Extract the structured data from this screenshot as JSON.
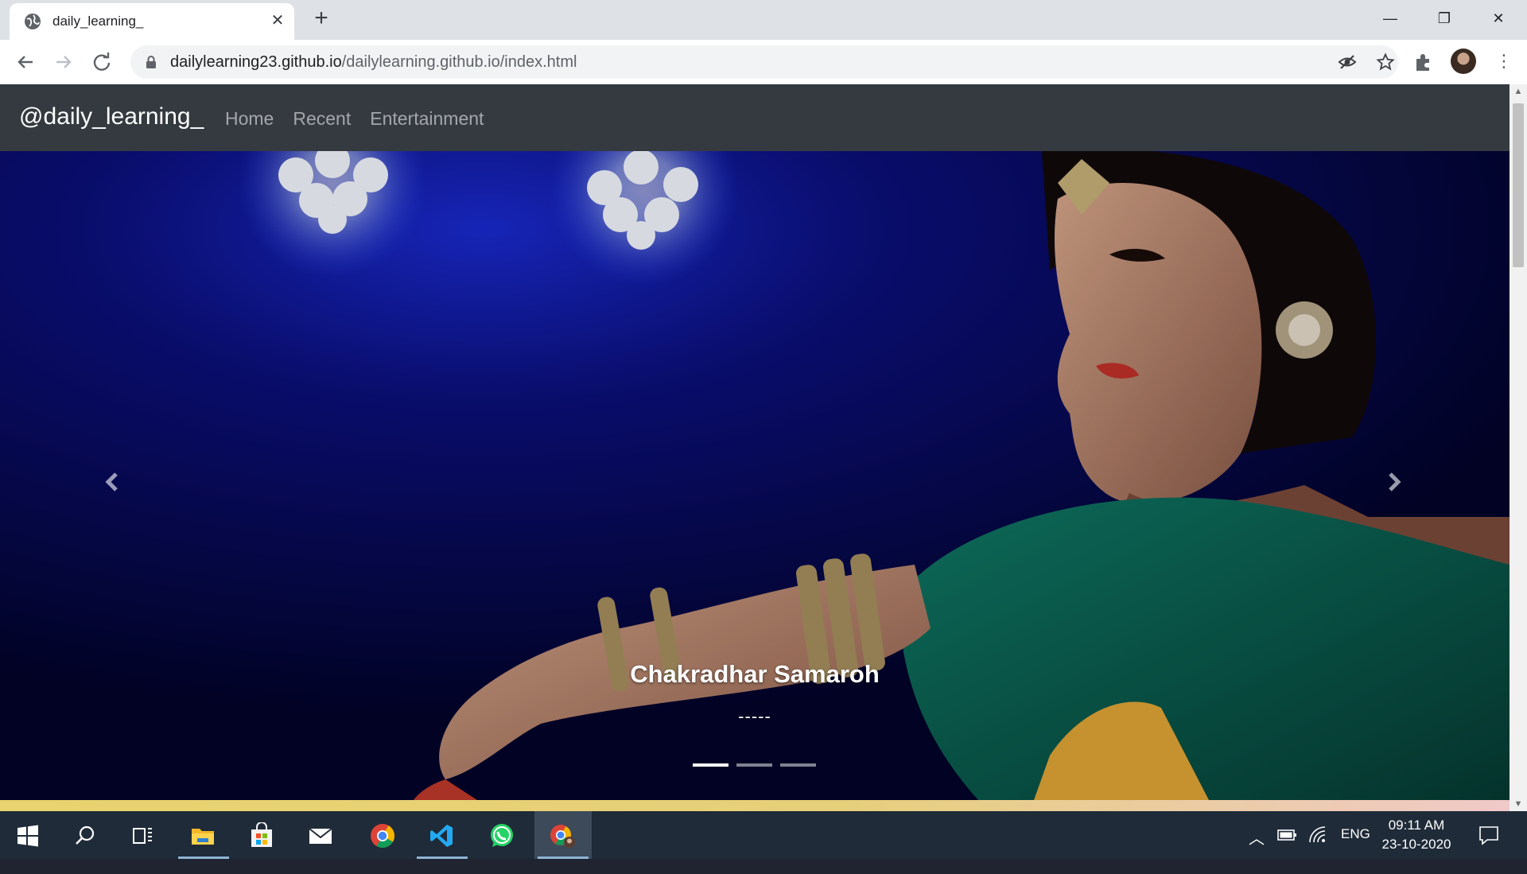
{
  "browser": {
    "tab_title": "daily_learning_",
    "url_host": "dailylearning23.github.io",
    "url_path": "/dailylearning.github.io/index.html",
    "new_tab_label": "+",
    "close_tab_label": "✕",
    "window": {
      "minimize": "—",
      "restore": "❐",
      "close": "✕"
    }
  },
  "site": {
    "brand": "@daily_learning_",
    "nav": [
      {
        "label": "Home"
      },
      {
        "label": "Recent"
      },
      {
        "label": "Entertainment"
      }
    ]
  },
  "carousel": {
    "caption_title": "Chakradhar Samaroh",
    "caption_subtitle": "-----",
    "slide_count": 3,
    "active_index": 0,
    "prev_icon": "chevron-left-icon",
    "next_icon": "chevron-right-icon"
  },
  "taskbar": {
    "apps": [
      "windows-start-icon",
      "search-icon",
      "task-view-icon",
      "file-explorer-icon",
      "store-icon",
      "mail-icon",
      "chrome-icon",
      "vscode-icon",
      "whatsapp-icon",
      "chrome-profile-icon"
    ],
    "tray_language": "ENG",
    "clock_time": "09:11 AM",
    "clock_date": "23-10-2020"
  },
  "colors": {
    "navbar_bg": "#343a40",
    "chrome_frame": "#dee1e6",
    "taskbar_bg": "#1f2b38"
  }
}
